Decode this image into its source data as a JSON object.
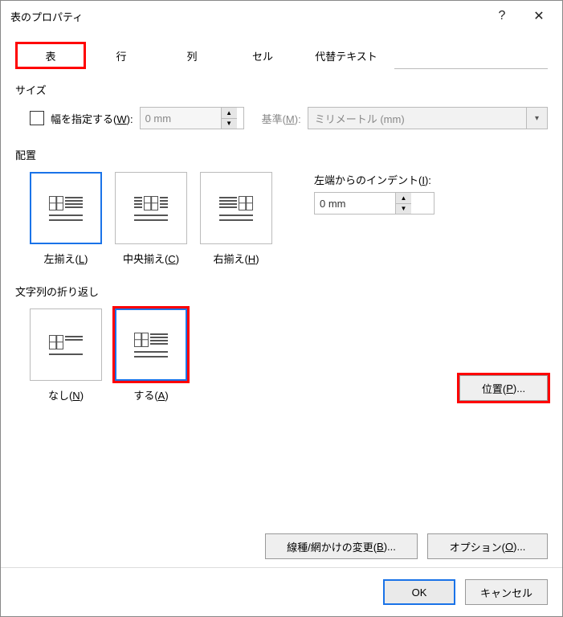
{
  "titlebar": {
    "title": "表のプロパティ",
    "help": "?",
    "close": "✕"
  },
  "tabs": {
    "t0": "表",
    "t1": "行",
    "t2": "列",
    "t3": "セル",
    "t4": "代替テキスト"
  },
  "size": {
    "section": "サイズ",
    "specify_width": "幅を指定する(",
    "specify_width_key": "W",
    "specify_width_end": "):",
    "width_value": "0 mm",
    "unit_label": "基準(",
    "unit_key": "M",
    "unit_end": "):",
    "unit_value": "ミリメートル (mm)"
  },
  "align": {
    "section": "配置",
    "left": "左揃え(",
    "left_key": "L",
    "left_end": ")",
    "center": "中央揃え(",
    "center_key": "C",
    "center_end": ")",
    "right": "右揃え(",
    "right_key": "H",
    "right_end": ")",
    "indent_label": "左端からのインデント(",
    "indent_key": "I",
    "indent_end": "):",
    "indent_value": "0 mm"
  },
  "wrap": {
    "section": "文字列の折り返し",
    "none": "なし(",
    "none_key": "N",
    "none_end": ")",
    "around": "する(",
    "around_key": "A",
    "around_end": ")",
    "position_btn": "位置(",
    "position_key": "P",
    "position_end": ")..."
  },
  "buttons": {
    "borders": "線種/網かけの変更(",
    "borders_key": "B",
    "borders_end": ")...",
    "options": "オプション(",
    "options_key": "O",
    "options_end": ")...",
    "ok": "OK",
    "cancel": "キャンセル"
  }
}
